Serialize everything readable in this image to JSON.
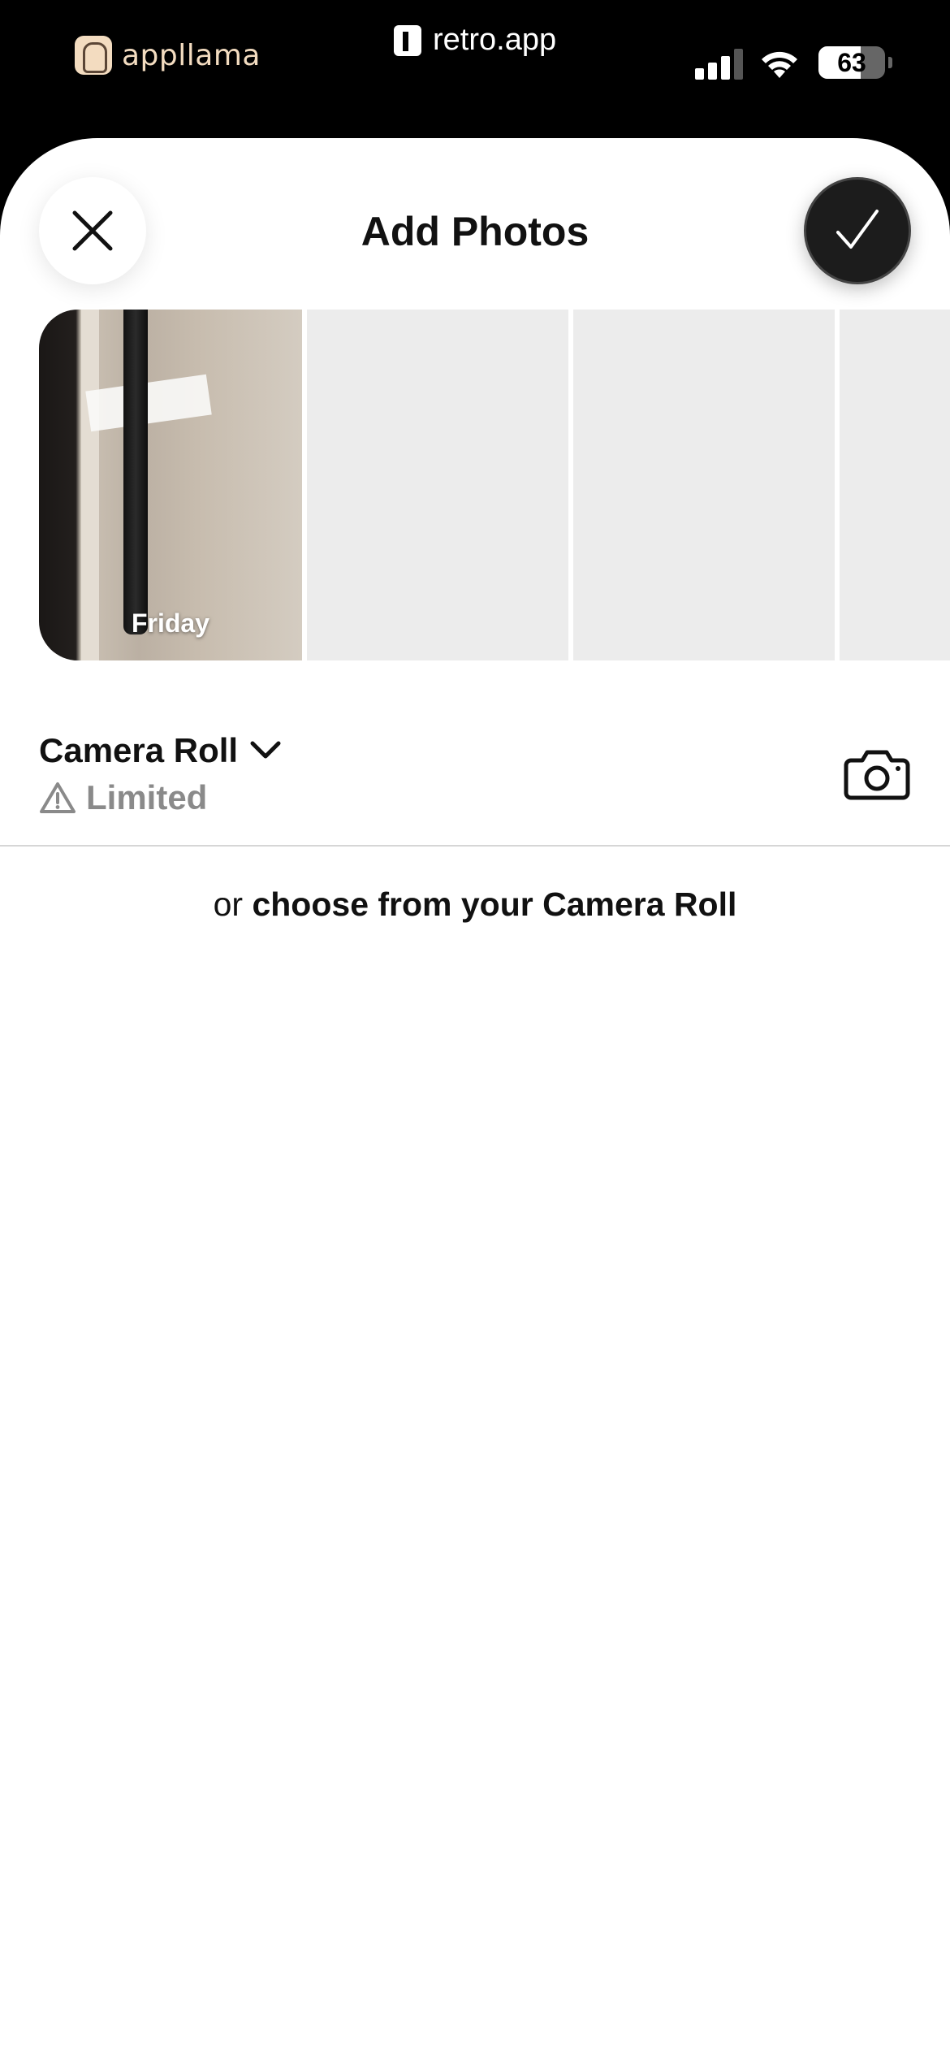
{
  "status_bar": {
    "brand": "appllama",
    "site": "retro.app",
    "battery_level": "63",
    "battery_fraction": 0.63,
    "signal_bars_active": 3,
    "signal_bars_total": 4
  },
  "header": {
    "title": "Add Photos"
  },
  "photos": [
    {
      "label": "Friday"
    },
    {
      "label": ""
    },
    {
      "label": ""
    },
    {
      "label": ""
    }
  ],
  "album": {
    "name": "Camera Roll",
    "access_status": "Limited"
  },
  "choose": {
    "prefix": "or ",
    "emphasis": "choose from your Camera Roll"
  },
  "icons": {
    "close": "close-icon",
    "done": "checkmark-icon",
    "dropdown": "chevron-down-icon",
    "warning": "warning-triangle-icon",
    "camera": "camera-icon"
  },
  "colors": {
    "sheet": "#ffffff",
    "done_button": "#1c1c1c",
    "placeholder_tile": "#ececec",
    "muted_text": "#8a8a8a",
    "brand": "#f3dcc0"
  }
}
